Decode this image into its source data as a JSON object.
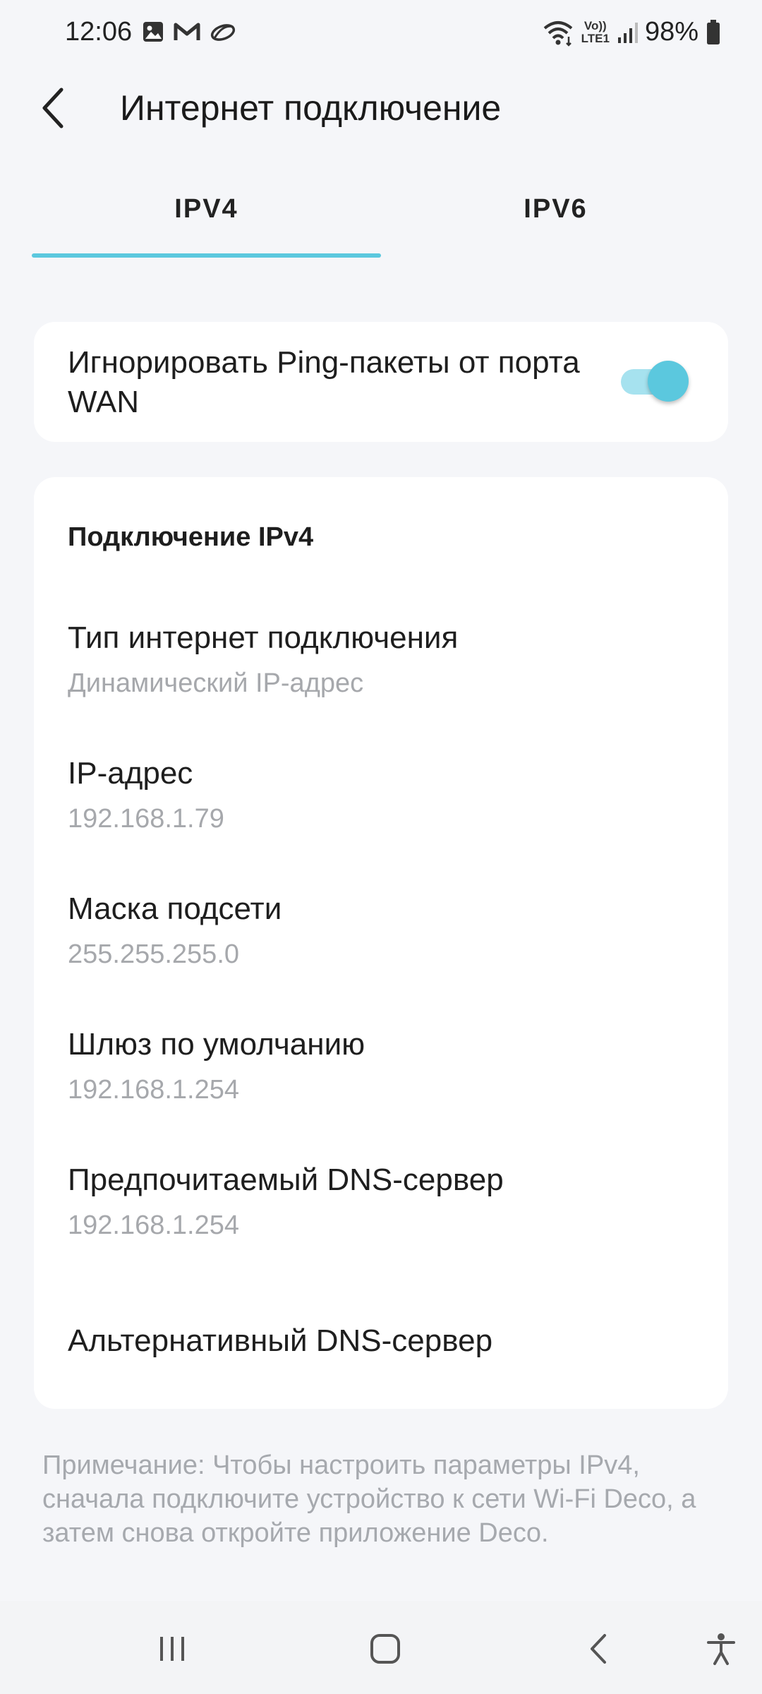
{
  "status_bar": {
    "time": "12:06",
    "battery": "98%",
    "icons": [
      "gallery-icon",
      "gmail-icon",
      "cloud-icon",
      "wifi-icon",
      "volte-icon",
      "signal-icon",
      "battery-icon"
    ],
    "volte_text": "Vo))",
    "lte_text": "LTE1"
  },
  "header": {
    "title": "Интернет подключение"
  },
  "tabs": [
    {
      "label": "IPV4",
      "active": true
    },
    {
      "label": "IPV6",
      "active": false
    }
  ],
  "accent_color": "#5bc8de",
  "ping_setting": {
    "label": "Игнорировать Ping-пакеты от порта WAN",
    "enabled": true
  },
  "ipv4_section": {
    "title": "Подключение IPv4",
    "fields": [
      {
        "label": "Тип интернет подключения",
        "value": "Динамический IP-адрес"
      },
      {
        "label": "IP-адрес",
        "value": "192.168.1.79"
      },
      {
        "label": "Маска подсети",
        "value": "255.255.255.0"
      },
      {
        "label": "Шлюз по умолчанию",
        "value": "192.168.1.254"
      },
      {
        "label": "Предпочитаемый DNS-сервер",
        "value": "192.168.1.254"
      },
      {
        "label": "Альтернативный DNS-сервер",
        "value": ""
      }
    ]
  },
  "note": "Примечание: Чтобы настроить параметры IPv4, сначала подключите устройство к сети Wi-Fi Deco, а затем снова откройте приложение Deco.",
  "nav_bar": {
    "buttons": [
      "recent-apps-icon",
      "home-icon",
      "back-icon",
      "accessibility-icon"
    ]
  }
}
